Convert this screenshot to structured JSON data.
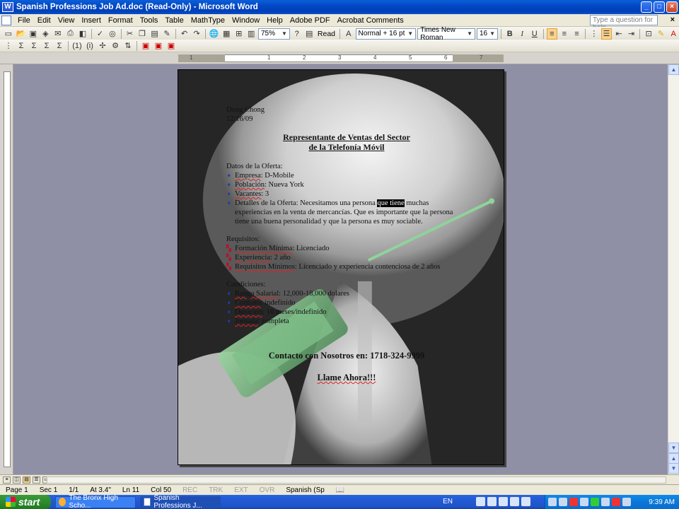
{
  "window": {
    "title": "Spanish Professions Job Ad.doc (Read-Only) - Microsoft Word"
  },
  "menu": {
    "items": [
      "File",
      "Edit",
      "View",
      "Insert",
      "Format",
      "Tools",
      "Table",
      "MathType",
      "Window",
      "Help",
      "Adobe PDF",
      "Acrobat Comments"
    ],
    "help_placeholder": "Type a question for help"
  },
  "toolbar": {
    "zoom": "75%",
    "read_label": "Read",
    "style": "Normal + 16 pt",
    "font": "Times New Roman",
    "size": "16",
    "bold": "B",
    "italic": "I",
    "underline": "U"
  },
  "toolbar2": {
    "items": [
      "Σ",
      "Σ",
      "Σ",
      "Σ",
      "(1)",
      "(i)"
    ]
  },
  "document": {
    "author": "Dong Chong",
    "date": "12/16/09",
    "title_line1": "Representante de Ventas del Sector",
    "title_line2": "de la Telefonía Móvil",
    "offer_heading": "Datos de la Oferta:",
    "offer": [
      {
        "label": "Empresa",
        "value": ": D-Mobile"
      },
      {
        "label": "Población",
        "value": ": Nueva York"
      },
      {
        "label": "Vacantes",
        "value": ": 3"
      }
    ],
    "details_label": "Detalles de la Oferta: Necesitamos una persona ",
    "details_highlight": "que tiene",
    "details_rest": "muchas experiencias en la venta de mercancías. Que es importante que la persona tiene una buena personalidad y que la persona es muy sociable.",
    "req_heading": "Requisitos:",
    "requirements": [
      {
        "label": "Formación Mínima",
        "value": ": Licenciado"
      },
      {
        "label": "Experiencia",
        "value": ": 2 año"
      },
      {
        "label": "Requisitos Mínimos",
        "value": ": Licenciado y experiencia contenciosa de 2 años"
      }
    ],
    "cond_heading": "Condiciones:",
    "conditions": [
      {
        "label": "Rango Salarial",
        "value": ": 12,000-18,000 dolares"
      },
      {
        "label": "Contrato",
        "value": ": indefinido"
      },
      {
        "label": "Duración",
        "value": ": 10 meses/indefinido"
      },
      {
        "label": "Jornada",
        "value": ": completa"
      }
    ],
    "contact": "Contacto con Nosotros en: 1718-324-9999",
    "call": "Llame Ahora!!!"
  },
  "ruler": {
    "numbers": [
      "1",
      "1",
      "2",
      "3",
      "4",
      "5",
      "6",
      "7"
    ]
  },
  "status": {
    "page": "Page 1",
    "sec": "Sec 1",
    "count": "1/1",
    "at": "At 3.4\"",
    "ln": "Ln 11",
    "col": "Col 50",
    "rec": "REC",
    "trk": "TRK",
    "ext": "EXT",
    "ovr": "OVR",
    "lang": "Spanish (Sp"
  },
  "taskbar": {
    "start": "start",
    "tasks": [
      "The Bronx High Scho...",
      "Spanish Professions J..."
    ],
    "lang": "EN",
    "clock": "9:39 AM"
  }
}
